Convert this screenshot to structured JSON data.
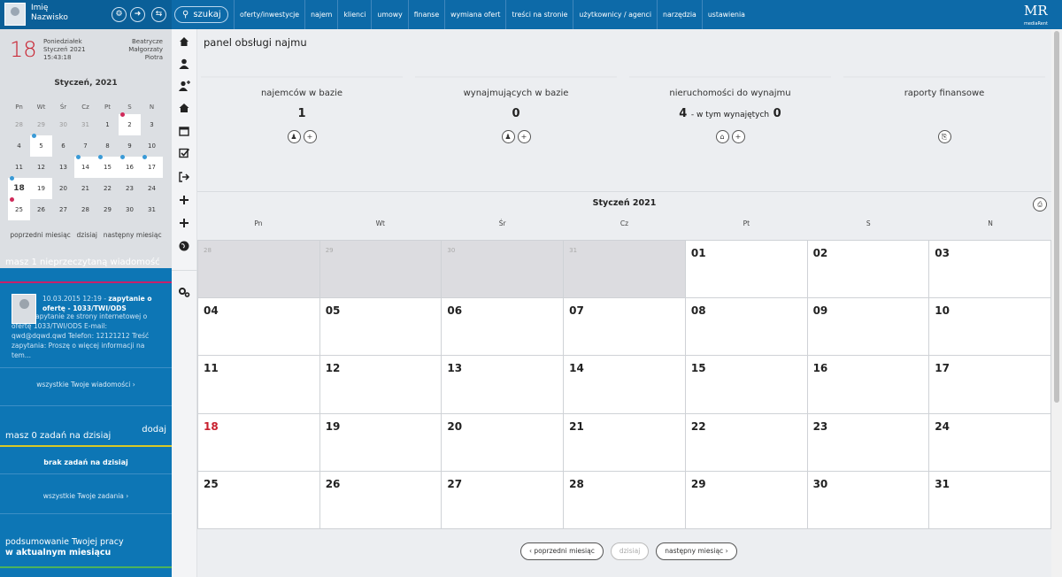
{
  "user": {
    "first": "Imię",
    "last": "Nazwisko"
  },
  "search": {
    "label": "szukaj"
  },
  "menu": [
    "oferty/inwestycje",
    "najem",
    "klienci",
    "umowy",
    "finanse",
    "wymiana ofert",
    "treści na stronie",
    "użytkownicy / agenci",
    "narzędzia",
    "ustawienia"
  ],
  "logo": {
    "text": "MR",
    "sub": "mediaRent"
  },
  "today": {
    "day": "18",
    "weekday": "Poniedziałek",
    "monthyear": "Styczeń 2021",
    "time": "15:43:18",
    "names1": "Beatrycze",
    "names2": "Małgorzaty",
    "names3": "Piotra"
  },
  "minical": {
    "title": "Styczeń, 2021",
    "days": [
      "Pn",
      "Wt",
      "Śr",
      "Cz",
      "Pt",
      "S",
      "N"
    ],
    "rows": [
      [
        "28",
        "29",
        "30",
        "31",
        "1",
        "2",
        "3"
      ],
      [
        "4",
        "5",
        "6",
        "7",
        "8",
        "9",
        "10"
      ],
      [
        "11",
        "12",
        "13",
        "14",
        "15",
        "16",
        "17"
      ],
      [
        "18",
        "19",
        "20",
        "21",
        "22",
        "23",
        "24"
      ],
      [
        "25",
        "26",
        "27",
        "28",
        "29",
        "30",
        "31"
      ]
    ],
    "prev": "poprzedni miesiąc",
    "today": "dzisiaj",
    "next": "następny miesiąc"
  },
  "messages": {
    "header": "masz 1 nieprzeczytaną wiadomość",
    "date": "10.03.2015 12:19 -",
    "subject": "zapytanie o ofertę - 1033/TWI/ODS",
    "body": "Zapytanie ze strony internetowej o ofertę 1033/TWI/ODS E-mail: qwd@dqwd.qwd Telefon: 12121212 Treść zapytania: Proszę o więcej informacji na tem...",
    "all": "wszystkie Twoje wiadomości"
  },
  "tasks": {
    "header": "masz 0 zadań na dzisiaj",
    "add": "dodaj",
    "empty": "brak zadań na dzisiaj",
    "all": "wszystkie Twoje zadania"
  },
  "summary": {
    "line1": "podsumowanie Twojej pracy",
    "line2": "w aktualnym miesiącu"
  },
  "page": {
    "title": "panel obsługi najmu"
  },
  "stats": {
    "tenants": {
      "label": "najemców w bazie",
      "value": "1"
    },
    "landlords": {
      "label": "wynajmujących w bazie",
      "value": "0"
    },
    "properties": {
      "label": "nieruchomości do wynajmu",
      "value": "4",
      "mid": "- w tym wynajętych",
      "rented": "0"
    },
    "reports": {
      "label": "raporty finansowe"
    }
  },
  "calendar": {
    "title": "Styczeń 2021",
    "days": [
      "Pn",
      "Wt",
      "Śr",
      "Cz",
      "Pt",
      "S",
      "N"
    ],
    "cells": [
      "28",
      "29",
      "30",
      "31",
      "01",
      "02",
      "03",
      "04",
      "05",
      "06",
      "07",
      "08",
      "09",
      "10",
      "11",
      "12",
      "13",
      "14",
      "15",
      "16",
      "17",
      "18",
      "19",
      "20",
      "21",
      "22",
      "23",
      "24",
      "25",
      "26",
      "27",
      "28",
      "29",
      "30",
      "31"
    ],
    "other_count": 4,
    "today_index": 21,
    "prev": "poprzedni miesiąc",
    "today": "dzisiaj",
    "next": "następny miesiąc"
  },
  "colors": {
    "accent": "#0d76b5",
    "today": "#c8202e"
  }
}
